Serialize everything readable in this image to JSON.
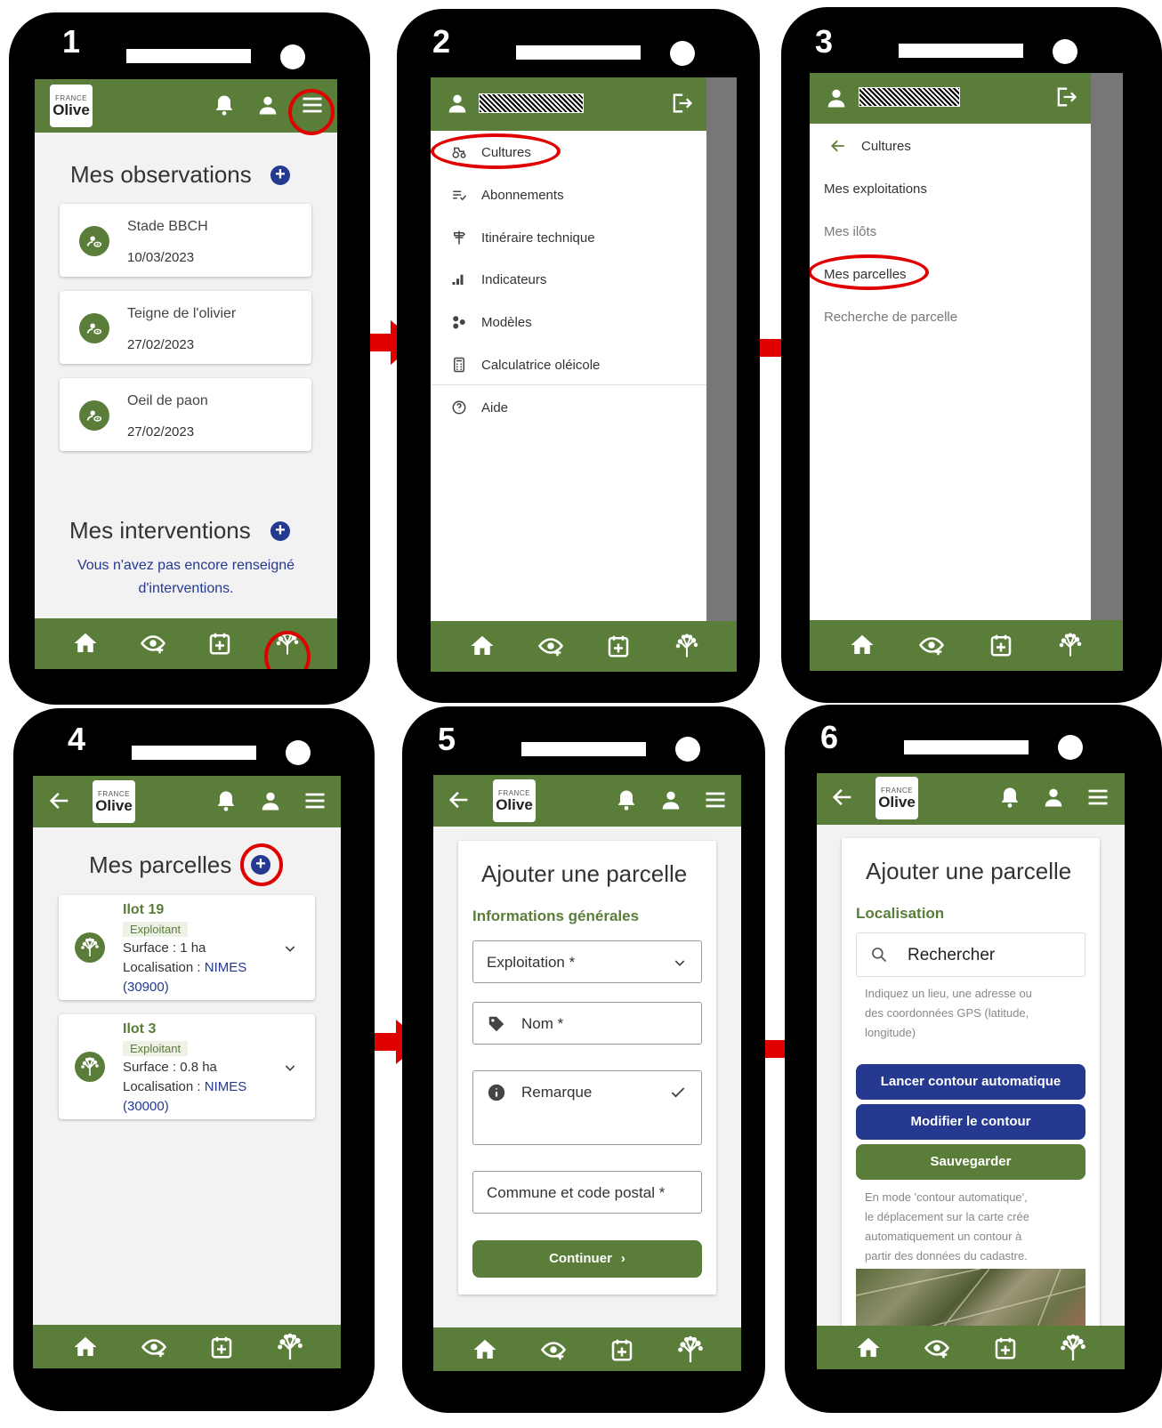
{
  "steps": [
    "1",
    "2",
    "3",
    "4",
    "5",
    "6"
  ],
  "logo": {
    "line1": "FRANCE",
    "line2": "Olive"
  },
  "screen1": {
    "title": "Mes observations",
    "observations": [
      {
        "name": "Stade BBCH",
        "date": "10/03/2023"
      },
      {
        "name": "Teigne de l'olivier",
        "date": "27/02/2023"
      },
      {
        "name": "Oeil de paon",
        "date": "27/02/2023"
      }
    ],
    "interventions_title": "Mes interventions",
    "interventions_empty_line1": "Vous n'avez pas encore renseigné",
    "interventions_empty_line2": "d'interventions."
  },
  "screen2": {
    "menu": [
      "Cultures",
      "Abonnements",
      "Itinéraire technique",
      "Indicateurs",
      "Modèles",
      "Calculatrice oléicole",
      "Aide"
    ]
  },
  "screen3": {
    "back_label": "Cultures",
    "items": [
      "Mes exploitations",
      "Mes ilôts",
      "Mes parcelles",
      "Recherche de parcelle"
    ]
  },
  "screen4": {
    "title": "Mes parcelles",
    "parcels": [
      {
        "name": "Ilot 19",
        "role": "Exploitant",
        "surface": "Surface : 1 ha",
        "loc_label": "Localisation : ",
        "loc_city": "NIMES",
        "loc_code": "(30900)"
      },
      {
        "name": "Ilot 3",
        "role": "Exploitant",
        "surface": "Surface : 0.8 ha",
        "loc_label": "Localisation : ",
        "loc_city": "NIMES",
        "loc_code": "(30000)"
      }
    ]
  },
  "screen5": {
    "title": "Ajouter une parcelle",
    "section": "Informations générales",
    "exploitation": "Exploitation *",
    "nom": "Nom *",
    "remarque": "Remarque",
    "commune": "Commune et code postal *",
    "continue": "Continuer"
  },
  "screen6": {
    "title": "Ajouter une parcelle",
    "section": "Localisation",
    "search_placeholder": "Rechercher",
    "hint_lines": [
      "Indiquez un lieu, une adresse ou",
      "des coordonnées GPS (latitude,",
      "longitude)"
    ],
    "btn_auto": "Lancer contour automatique",
    "btn_modify": "Modifier le contour",
    "btn_save": "Sauvegarder",
    "note_lines": [
      "En mode 'contour automatique',",
      "le déplacement sur la carte crée",
      "automatiquement un contour à",
      "partir des données du cadastre."
    ]
  },
  "colors": {
    "green": "#5a7d3a",
    "navy": "#24398f",
    "red": "#e00000"
  }
}
